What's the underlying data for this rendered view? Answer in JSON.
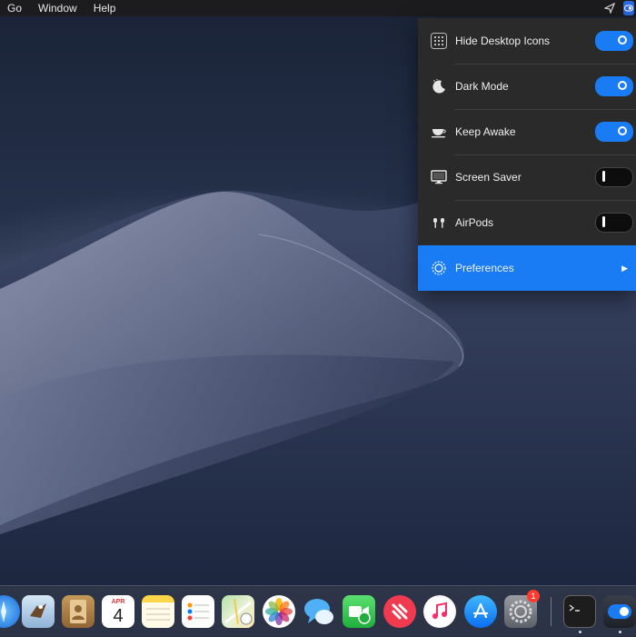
{
  "menubar": {
    "items": [
      "Go",
      "Window",
      "Help"
    ],
    "status_icons": [
      "navigation-icon",
      "one-switch-icon"
    ]
  },
  "panel": {
    "rows": [
      {
        "label": "Hide Desktop Icons",
        "icon": "grid-icon",
        "state": "on"
      },
      {
        "label": "Dark Mode",
        "icon": "moon-icon",
        "state": "on"
      },
      {
        "label": "Keep Awake",
        "icon": "coffee-cup-icon",
        "state": "on"
      },
      {
        "label": "Screen Saver",
        "icon": "monitor-icon",
        "state": "off"
      },
      {
        "label": "AirPods",
        "icon": "airpods-icon",
        "state": "off"
      }
    ],
    "preferences": {
      "label": "Preferences",
      "icon": "gear-icon",
      "chevron": "▶"
    }
  },
  "dock": {
    "calendar": {
      "month": "APR",
      "day": "4"
    },
    "badge_count": "1",
    "apps": [
      "safari-icon",
      "mail-icon",
      "contacts-icon",
      "calendar-icon",
      "notes-icon",
      "reminders-icon",
      "maps-icon",
      "photos-icon",
      "messages-icon",
      "facetime-icon",
      "news-icon",
      "music-icon",
      "app-store-icon",
      "system-preferences-icon",
      "terminal-icon",
      "one-switch-icon"
    ]
  },
  "colors": {
    "accent": "#1a7cf5",
    "panel_bg": "#2a2a2a",
    "menubar_bg": "#1c1c1e"
  }
}
